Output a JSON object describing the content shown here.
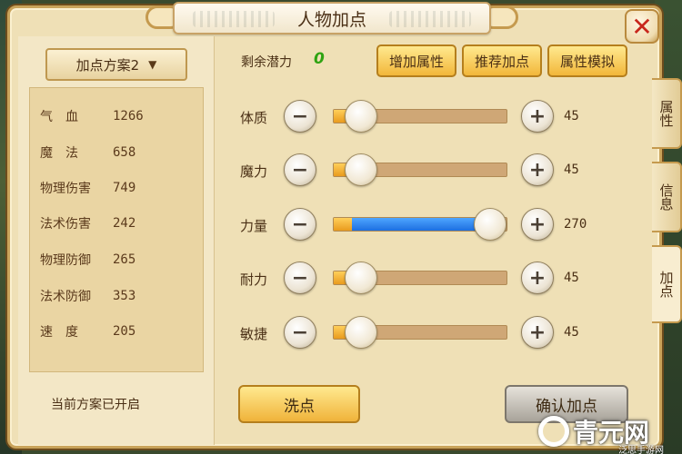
{
  "title": "人物加点",
  "plan_select": {
    "label": "加点方案2",
    "icon": "chevron-down-icon"
  },
  "stats": [
    {
      "label": "气　血",
      "value": "1266"
    },
    {
      "label": "魔　法",
      "value": "658"
    },
    {
      "label": "物理伤害",
      "value": "749"
    },
    {
      "label": "法术伤害",
      "value": "242"
    },
    {
      "label": "物理防御",
      "value": "265"
    },
    {
      "label": "法术防御",
      "value": "353"
    },
    {
      "label": "速　度",
      "value": "205"
    }
  ],
  "plan_status": "当前方案已开启",
  "potential": {
    "label": "剩余潜力",
    "value": "0",
    "color": "#2fa312"
  },
  "top_buttons": [
    "增加属性",
    "推荐加点",
    "属性模拟"
  ],
  "attributes": [
    {
      "label": "体质",
      "value": "45",
      "level": 0.0
    },
    {
      "label": "魔力",
      "value": "45",
      "level": 0.0
    },
    {
      "label": "力量",
      "value": "270",
      "level": 1.0
    },
    {
      "label": "耐力",
      "value": "45",
      "level": 0.0
    },
    {
      "label": "敏捷",
      "value": "45",
      "level": 0.0
    }
  ],
  "bottom_buttons": {
    "wash": "洗点",
    "confirm": "确认加点"
  },
  "side_tabs": [
    {
      "label": "属性",
      "active": false
    },
    {
      "label": "信息",
      "active": false
    },
    {
      "label": "加点",
      "active": true
    }
  ],
  "close_icon": "close-icon",
  "watermark": {
    "text": "青元网",
    "sub": "泛思手游网"
  },
  "colors": {
    "panel": "#efe0b6",
    "accent_gold": "#f2b73a",
    "slider_fill": "#1d6fe0",
    "close_red": "#c8271c"
  }
}
